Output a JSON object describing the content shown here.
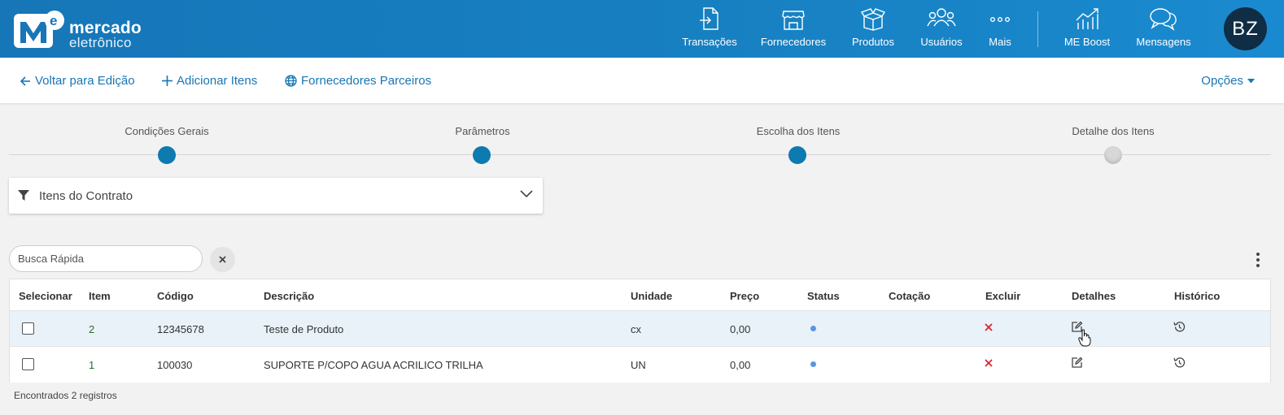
{
  "header": {
    "brand_line1": "mercado",
    "brand_line2": "eletrônico",
    "nav": [
      {
        "label": "Transações",
        "icon": "transactions-icon"
      },
      {
        "label": "Fornecedores",
        "icon": "store-icon"
      },
      {
        "label": "Produtos",
        "icon": "box-icon"
      },
      {
        "label": "Usuários",
        "icon": "users-icon"
      },
      {
        "label": "Mais",
        "icon": "more-dots-icon"
      },
      {
        "label": "ME Boost",
        "icon": "chart-icon"
      },
      {
        "label": "Mensagens",
        "icon": "chat-icon"
      }
    ],
    "avatar_initials": "BZ"
  },
  "actions": {
    "back": "Voltar para Edição",
    "add_items": "Adicionar Itens",
    "partner_suppliers": "Fornecedores Parceiros",
    "options": "Opções"
  },
  "stepper": {
    "steps": [
      {
        "label": "Condições Gerais",
        "state": "done"
      },
      {
        "label": "Parâmetros",
        "state": "done"
      },
      {
        "label": "Escolha dos Itens",
        "state": "done"
      },
      {
        "label": "Detalhe dos Itens",
        "state": "pending"
      }
    ]
  },
  "filter": {
    "title": "Itens do Contrato"
  },
  "search": {
    "placeholder": "Busca Rápida"
  },
  "table": {
    "columns": [
      "Selecionar",
      "Item",
      "Código",
      "Descrição",
      "Unidade",
      "Preço",
      "Status",
      "Cotação",
      "Excluir",
      "Detalhes",
      "Histórico"
    ],
    "rows": [
      {
        "item": "2",
        "codigo": "12345678",
        "descricao": "Teste de Produto",
        "unidade": "cx",
        "preco": "0,00",
        "cotacao": ""
      },
      {
        "item": "1",
        "codigo": "100030",
        "descricao": "SUPORTE P/COPO AGUA ACRILICO TRILHA",
        "unidade": "UN",
        "preco": "0,00",
        "cotacao": ""
      }
    ]
  },
  "footer": {
    "count_text": "Encontrados 2 registros"
  },
  "colors": {
    "header": "#1780c1",
    "accent": "#1776b5",
    "step_done": "#0d7ab0",
    "delete": "#d9262c",
    "status": "#5b95e8"
  }
}
